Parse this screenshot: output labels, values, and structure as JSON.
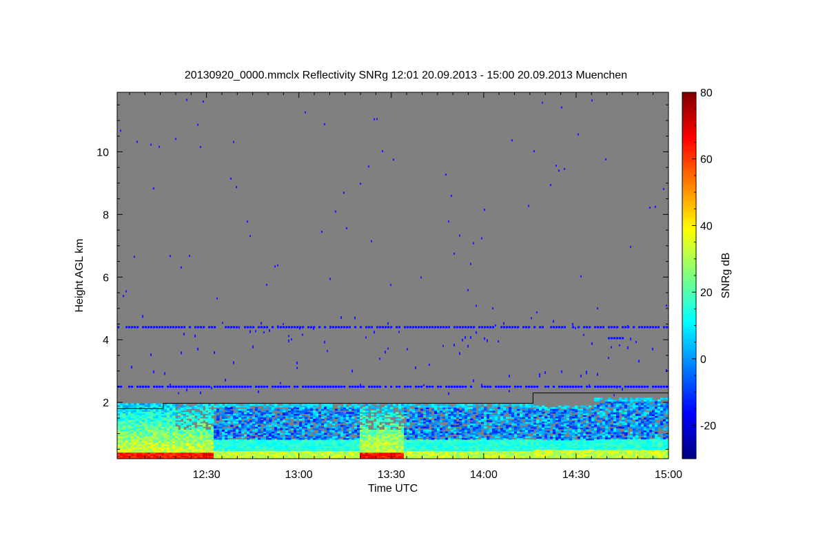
{
  "chart_data": {
    "type": "heatmap",
    "title": "20130920_0000.mmclx Reflectivity SNRg   12:01 20.09.2013 - 15:00 20.09.2013 Muenchen",
    "xlabel": "Time UTC",
    "ylabel": "Height AGL km",
    "colorbar_label": "SNRg dB",
    "x_range": [
      "12:01",
      "15:00"
    ],
    "y_range": [
      0.2,
      11.9
    ],
    "color_range": [
      -30,
      80
    ],
    "x_ticks": [
      {
        "value": "12:30",
        "label": "12:30"
      },
      {
        "value": "13:00",
        "label": "13:00"
      },
      {
        "value": "13:30",
        "label": "13:30"
      },
      {
        "value": "14:00",
        "label": "14:00"
      },
      {
        "value": "14:30",
        "label": "14:30"
      },
      {
        "value": "15:00",
        "label": "15:00"
      }
    ],
    "y_ticks": [
      {
        "value": 2,
        "label": "2"
      },
      {
        "value": 4,
        "label": "4"
      },
      {
        "value": 6,
        "label": "6"
      },
      {
        "value": 8,
        "label": "8"
      },
      {
        "value": 10,
        "label": "10"
      }
    ],
    "colorbar_ticks": [
      {
        "value": -20,
        "label": "-20"
      },
      {
        "value": 0,
        "label": "0"
      },
      {
        "value": 20,
        "label": "20"
      },
      {
        "value": 40,
        "label": "40"
      },
      {
        "value": 60,
        "label": "60"
      },
      {
        "value": 80,
        "label": "80"
      }
    ],
    "background_color": "#808080",
    "colormap": [
      "#00007f",
      "#0000ff",
      "#007fff",
      "#00ffff",
      "#7fff7f",
      "#ffff00",
      "#ff7f00",
      "#ff0000",
      "#7f0000"
    ],
    "boundary_line": [
      {
        "t": "12:01",
        "h": 1.8
      },
      {
        "t": "12:16",
        "h": 1.8
      },
      {
        "t": "12:16",
        "h": 1.97
      },
      {
        "t": "14:16",
        "h": 1.97
      },
      {
        "t": "14:16",
        "h": 2.3
      },
      {
        "t": "15:00",
        "h": 2.3
      }
    ],
    "noise_bands_km": [
      4.4,
      2.5,
      4.05
    ]
  }
}
